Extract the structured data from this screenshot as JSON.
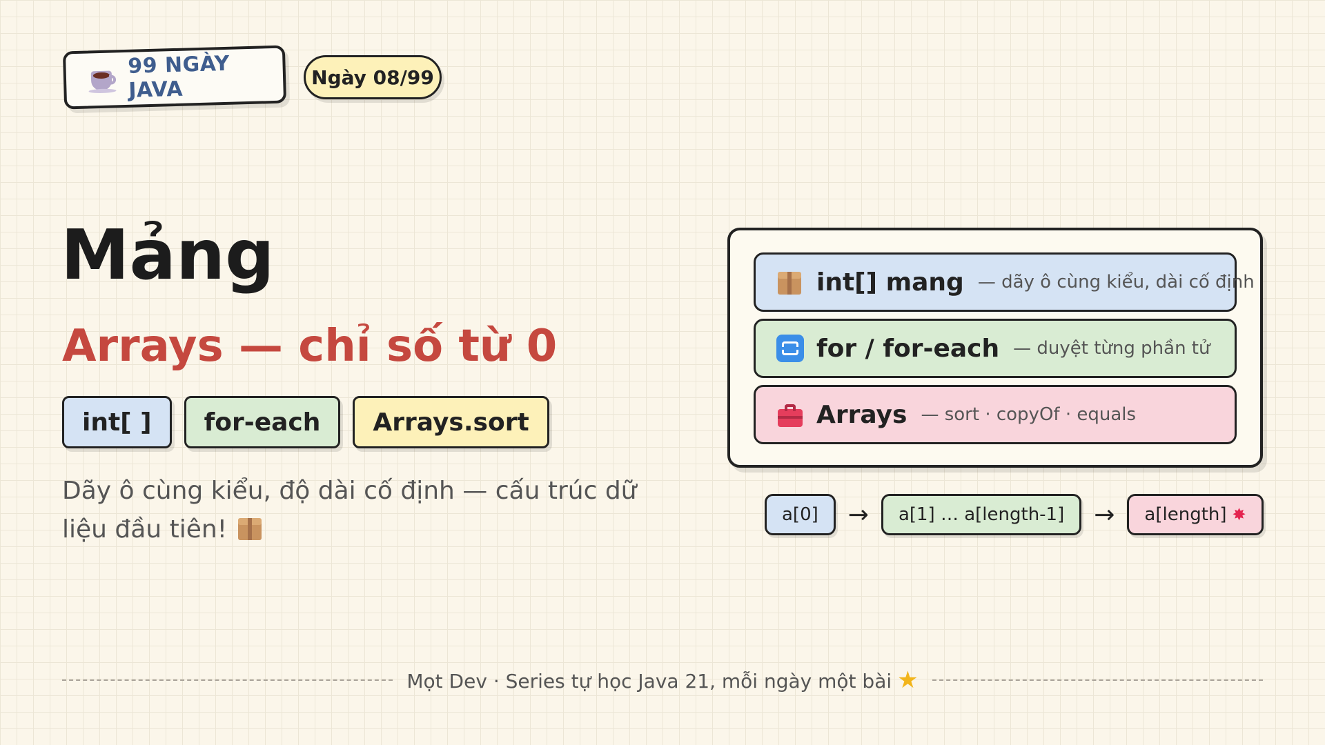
{
  "header": {
    "brand": "99 NGÀY JAVA",
    "day_badge": "Ngày 08/99"
  },
  "main": {
    "title": "Mảng",
    "subtitle": "Arrays — chỉ số từ 0",
    "chips": [
      "int[ ]",
      "for-each",
      "Arrays.sort"
    ],
    "description": "Dãy ô cùng kiểu, độ dài cố định — cấu trúc dữ liệu đầu tiên!"
  },
  "card": {
    "rows": [
      {
        "title": "int[] mang",
        "detail": "— dãy ô cùng kiểu, dài cố định",
        "icon": "package-icon"
      },
      {
        "title": "for / for-each",
        "detail": "— duyệt từng phần tử",
        "icon": "repeat-icon"
      },
      {
        "title": "Arrays",
        "detail": "— sort · copyOf · equals",
        "icon": "toolbox-icon"
      }
    ]
  },
  "flow": {
    "nodes": [
      "a[0]",
      "a[1] … a[length-1]",
      "a[length]"
    ],
    "arrow": "→",
    "spark": "✸"
  },
  "footer": {
    "text": "Mọt Dev · Series tự học Java 21, mỗi ngày một bài",
    "star": "★"
  },
  "colors": {
    "accent_red": "#c5483f",
    "brand_blue": "#3f5d8e",
    "chip_blue": "#d5e3f4",
    "chip_green": "#d9ecd3",
    "chip_yellow": "#fdf1b9",
    "chip_pink": "#f9d5dc"
  }
}
